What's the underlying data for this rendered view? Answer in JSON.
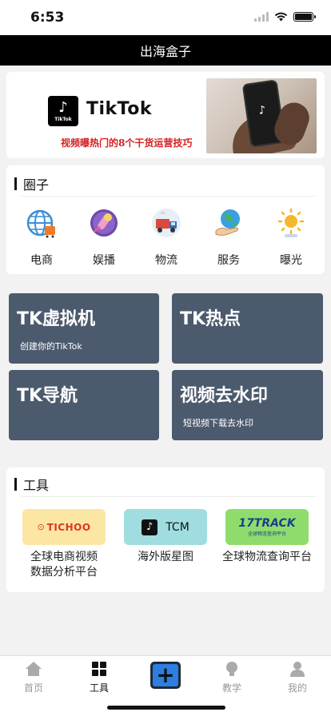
{
  "status": {
    "time": "6:53"
  },
  "nav": {
    "title": "出海盒子"
  },
  "banner": {
    "logo_text": "TikTok",
    "logo_small": "TikTok",
    "subtitle": "视频曝热门的8个干货运营技巧"
  },
  "circle": {
    "title": "圈子",
    "items": [
      {
        "label": "电商",
        "icon": "ecommerce-globe-icon"
      },
      {
        "label": "娱播",
        "icon": "microphone-icon"
      },
      {
        "label": "物流",
        "icon": "truck-icon"
      },
      {
        "label": "服务",
        "icon": "globe-hand-icon"
      },
      {
        "label": "曝光",
        "icon": "sun-icon"
      }
    ]
  },
  "tiles": [
    {
      "title": "TK虚拟机",
      "subtitle": "创建你的TikTok"
    },
    {
      "title": "TK热点",
      "subtitle": ""
    },
    {
      "title": "TK导航",
      "subtitle": ""
    },
    {
      "title": "视频去水印",
      "subtitle": "短视频下载去水印"
    }
  ],
  "tools": {
    "title": "工具",
    "items": [
      {
        "logo": "TICHOO",
        "name_line1": "全球电商视频",
        "name_line2": "数据分析平台",
        "color": "#fbe7a3"
      },
      {
        "logo": "TCM",
        "name_line1": "海外版星图",
        "name_line2": "",
        "color": "#9fdde0"
      },
      {
        "logo": "17TRACK",
        "logo_sub": "全球物流查询平台",
        "name_line1": "全球物流查询平台",
        "name_line2": "",
        "color": "#8fdc6c"
      }
    ]
  },
  "tabbar": {
    "items": [
      {
        "label": "首页"
      },
      {
        "label": "工具"
      },
      {
        "label": ""
      },
      {
        "label": "教学"
      },
      {
        "label": "我的"
      }
    ],
    "plus": "+"
  },
  "colors": {
    "tile_bg": "#4c5a6e",
    "nav_bg": "#000000",
    "accent_blue": "#2c7fe0"
  }
}
